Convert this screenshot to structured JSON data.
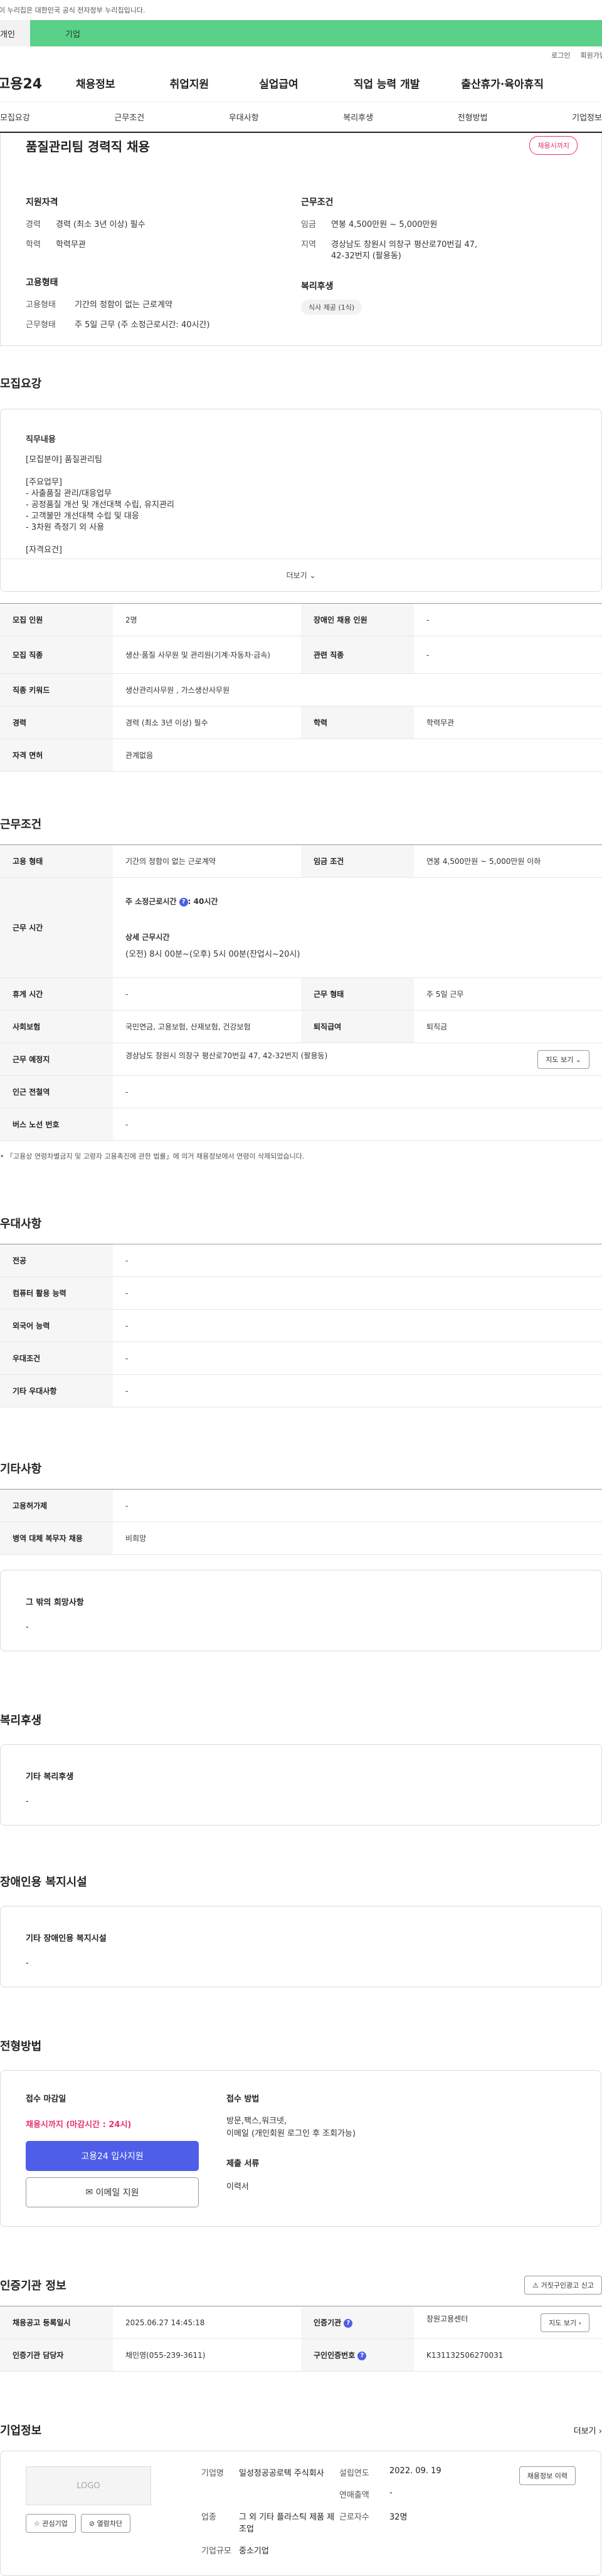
{
  "gov_banner": "이 누리집은 대한민국 공식 전자정부 누리집입니다.",
  "user_tabs": {
    "personal": "개인",
    "company": "기업"
  },
  "util": {
    "login": "로그인",
    "signup": "회원가입"
  },
  "logo": "고용24",
  "gnb": [
    "채용정보",
    "취업지원",
    "실업급여",
    "직업 능력 개발",
    "출산휴가·육아휴직"
  ],
  "subnav": [
    "모집요강",
    "근무조건",
    "우대사항",
    "복리후생",
    "전형방법",
    "기업정보"
  ],
  "summary": {
    "title": "품질관리팀 경력직 채용",
    "badge": "채용시까지",
    "qual_title": "지원자격",
    "qual": [
      {
        "k": "경력",
        "v": "경력 (최소 3년 이상) 필수"
      },
      {
        "k": "학력",
        "v": "학력무관"
      }
    ],
    "cond_title": "근무조건",
    "cond": [
      {
        "k": "임금",
        "v": "연봉 4,500만원 ~ 5,000만원"
      },
      {
        "k": "지역",
        "v": "경상남도 창원시 의창구 평산로70번길 47, 42-32번지 (팔용동)"
      }
    ],
    "emp_title": "고용형태",
    "emp": [
      {
        "k": "고용형태",
        "v": "기간의 정함이 없는 근로계약"
      },
      {
        "k": "근무형태",
        "v": "주 5일 근무 (주 소정근로시간: 40시간)"
      }
    ],
    "welfare_title": "복리후생",
    "welfare_chip": "식사 제공 (1식)"
  },
  "recruit": {
    "title": "모집요강",
    "duty_title": "직무내용",
    "duty_text": "[모집분야] 품질관리팀\n\n[주요업무]\n- 사출품질 관리/대응업무\n- 공정품질 개선 및 개선대책 수립, 유지관리\n- 고객불만 개선대책 수립 및 대응\n- 3차원 측정기 외 사용\n\n[자격요건]",
    "more": "더보기",
    "rows": [
      [
        "모집 인원",
        "2명",
        "장애인 채용 인원",
        "-"
      ],
      [
        "모집 직종",
        "생산·품질 사무원 및 관리원(기계·자동차·금속)",
        "관련 직종",
        "-"
      ],
      [
        "직종 키워드",
        "생산관리사무원 , 가스생산사무원"
      ],
      [
        "경력",
        "경력 (최소 3년 이상) 필수",
        "학력",
        "학력무관"
      ],
      [
        "자격 면허",
        "관계없음"
      ]
    ]
  },
  "work": {
    "title": "근무조건",
    "emp_type_k": "고용 형태",
    "emp_type_v": "기간의 정함이 없는 근로계약",
    "wage_k": "임금 조건",
    "wage_v": "연봉 4,500만원 ~ 5,000만원 이하",
    "hours_k": "근무 시간",
    "hours_weekly": "주 소정근로시간",
    "hours_weekly_v": ": 40시간",
    "hours_detail_title": "상세 근무시간",
    "hours_detail": "(오전) 8시 00분~(오후) 5시 00분(잔업시~20시)",
    "rest_k": "휴게 시간",
    "rest_v": "-",
    "worktype_k": "근무 형태",
    "worktype_v": "주 5일 근무",
    "ins_k": "사회보험",
    "ins_v": "국민연금, 고용보험, 산재보험, 건강보험",
    "retire_k": "퇴직급여",
    "retire_v": "퇴직금",
    "loc_k": "근무 예정지",
    "loc_v": "경상남도 창원시 의창구 평산로70번길 47, 42-32번지 (팔용동)",
    "map_btn": "지도 보기",
    "station_k": "인근 전철역",
    "station_v": "-",
    "bus_k": "버스 노선 번호",
    "bus_v": "-",
    "note": "「고용상 연령차별금지 및 고령자 고용촉진에 관한 법률」에 의거 채용정보에서 연령이 삭제되었습니다."
  },
  "pref": {
    "title": "우대사항",
    "rows": [
      [
        "전공",
        "-"
      ],
      [
        "컴퓨터 활용 능력",
        "-"
      ],
      [
        "외국어 능력",
        "-"
      ],
      [
        "우대조건",
        "-"
      ],
      [
        "기타 우대사항",
        "-"
      ]
    ]
  },
  "etc": {
    "title": "기타사항",
    "rows": [
      [
        "고용허가제",
        "-"
      ],
      [
        "병역 대체 복무자 채용",
        "비희망"
      ]
    ],
    "wish_title": "그 밖의 희망사항",
    "wish_value": "-"
  },
  "welfare": {
    "title": "복리후생",
    "box_title": "기타 복리후생",
    "box_value": "-"
  },
  "disabled": {
    "title": "장애인용 복지시설",
    "box_title": "기타 장애인용 복지시설",
    "box_value": "-"
  },
  "selection": {
    "title": "전형방법",
    "deadline_title": "접수 마감일",
    "deadline_value": "채용시까지 (마감시간 : 24시)",
    "apply_btn": "고용24 입사지원",
    "email_btn": "이메일 지원",
    "method_title": "접수 방법",
    "method_value": "방문,팩스,워크넷,\n이메일 (개인회원 로그인 후 조회가능)",
    "docs_title": "제출 서류",
    "docs_value": "이력서"
  },
  "cert": {
    "title": "인증기관 정보",
    "report_btn": "거짓구인광고 신고",
    "reg_k": "채용공고 등록일시",
    "reg_v": "2025.06.27 14:45:18",
    "agency_k": "인증기관",
    "agency_v": "창원고용센터",
    "map_btn": "지도 보기",
    "officer_k": "인증기관 담당자",
    "officer_v": "채인영(055-239-3611)",
    "cert_no_k": "구인인증번호",
    "cert_no_v": "K131132506270031"
  },
  "company": {
    "title": "기업정보",
    "more": "더보기",
    "logo": "LOGO",
    "fav_btn": "관심기업",
    "block_btn": "열람차단",
    "name_k": "기업명",
    "name_v": "일성정공공로텍 주식회사",
    "est_k": "설립연도",
    "est_v": "2022. 09. 19",
    "rev_k": "연매출액",
    "rev_v": "-",
    "ind_k": "업종",
    "ind_v": "그 외 기타 플라스틱 제품 제조업",
    "emp_k": "근로자수",
    "emp_v": "32명",
    "size_k": "기업규모",
    "size_v": "중소기업",
    "history_btn": "채용정보 이력"
  },
  "colors": {
    "accent": "#4f5ee8",
    "company_tab": "#5bd088",
    "badge": "#e8336a"
  }
}
